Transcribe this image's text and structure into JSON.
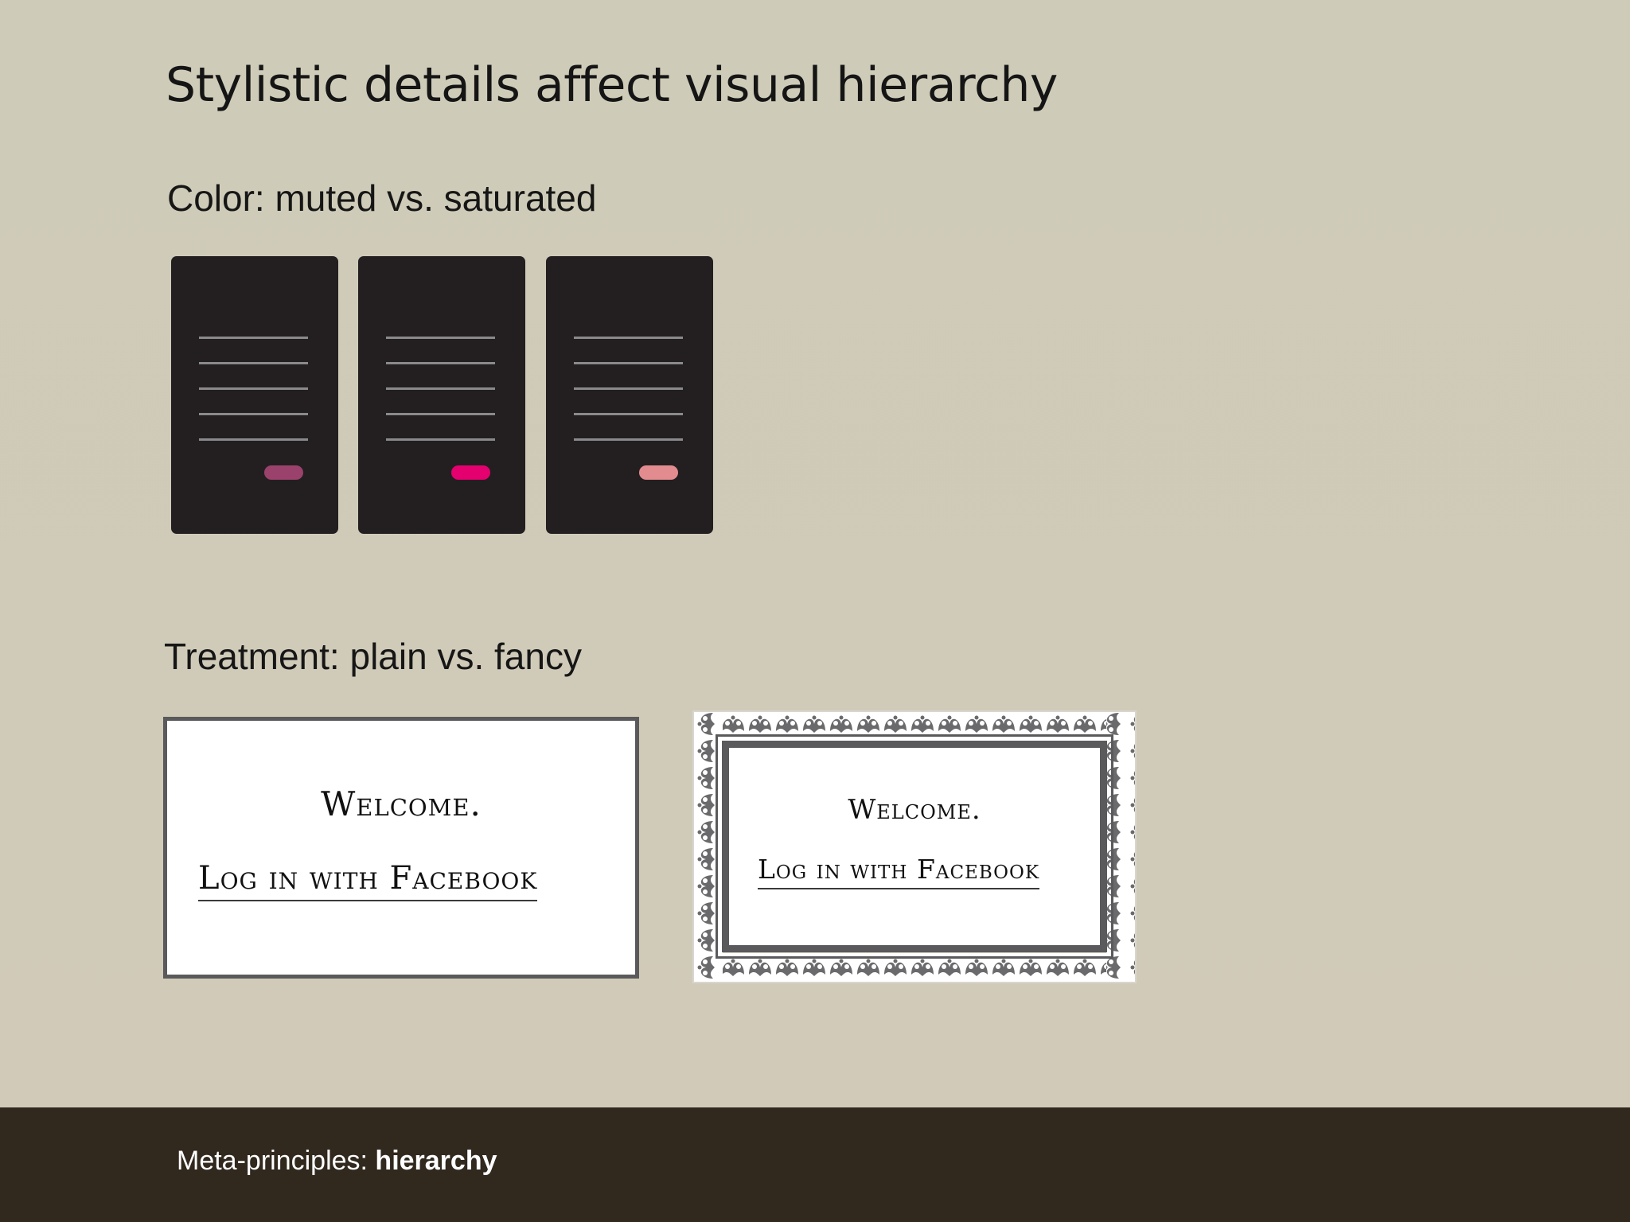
{
  "slide": {
    "title": "Stylistic details affect visual hierarchy",
    "sections": {
      "color": {
        "label": "Color: muted vs. saturated",
        "button_colors": [
          "#9a426c",
          "#e5006f",
          "#e28c8f"
        ]
      },
      "treatment": {
        "label": "Treatment: plain vs. fancy",
        "plain_card": {
          "welcome": "Welcome.",
          "login": "Log in with Facebook"
        },
        "fancy_card": {
          "welcome": "Welcome.",
          "login": "Log in with Facebook"
        }
      }
    }
  },
  "footer": {
    "prefix": "Meta-principles: ",
    "emphasis": "hierarchy"
  }
}
